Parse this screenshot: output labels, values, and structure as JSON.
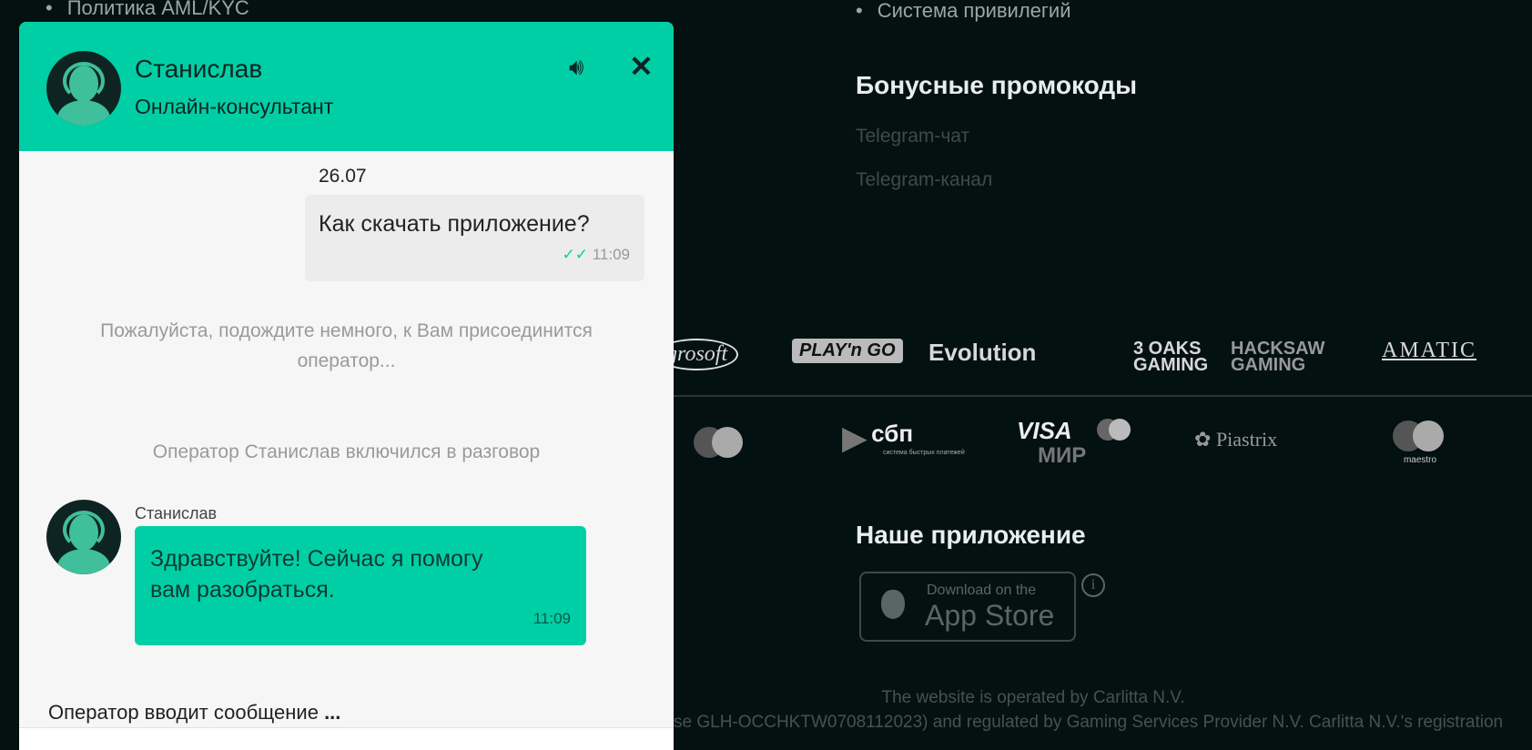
{
  "background_page": {
    "left_links": [
      "Политика AML/KYC"
    ],
    "right_links": [
      "Система привилегий"
    ],
    "promo": {
      "title": "Бонусные промокоды",
      "links": [
        "Telegram-чат",
        "Telegram-канал"
      ]
    },
    "providers": [
      "grosoft",
      "PLAY'n GO",
      "Evolution",
      "3 OAKS GAMING",
      "HACKSAW GAMING",
      "AMATIC"
    ],
    "payments": [
      "Mastercard",
      "сбп",
      "система быстрых платежей",
      "VISA",
      "МИР",
      "Piastrix",
      "maestro"
    ],
    "app": {
      "title": "Наше приложение",
      "badge_small": "Download on the",
      "badge_big": "App Store"
    },
    "footer": [
      "The website is operated by Carlitta N.V.",
      "se GLH-OCCHKTW0708112023) and regulated by Gaming Services Provider N.V. Carlitta N.V.'s registration"
    ]
  },
  "chat": {
    "accent": "#00cfa6",
    "header": {
      "name": "Станислав",
      "role": "Онлайн-консультант"
    },
    "date": "26.07",
    "user_message": {
      "text": "Как скачать приложение?",
      "time": "11:09"
    },
    "system_wait": [
      "Пожалуйста, подождите немного, к Вам присоединится",
      "оператор..."
    ],
    "system_joined": "Оператор Станислав включился в разговор",
    "operator_message": {
      "sender": "Станислав",
      "lines": [
        "Здравствуйте! Сейчас я помогу",
        "вам разобраться."
      ],
      "time": "11:09"
    },
    "typing": "Оператор вводит сообщение",
    "typing_dots": "..."
  }
}
